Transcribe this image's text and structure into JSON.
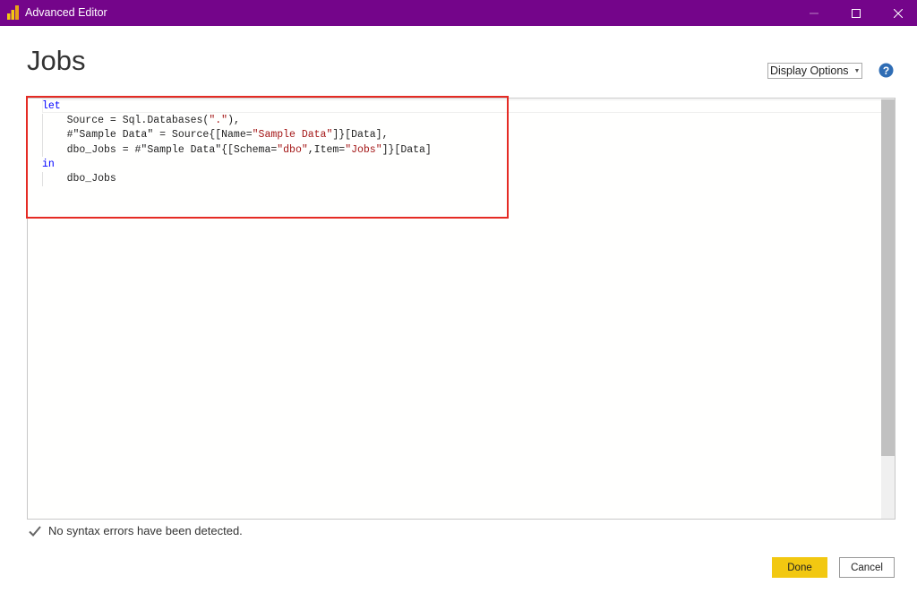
{
  "window": {
    "title": "Advanced Editor",
    "accent_color": "#74058a",
    "icon": "power-bi-icon",
    "controls": {
      "minimize_icon": "minimize-icon",
      "maximize_icon": "maximize-icon",
      "close_icon": "close-icon"
    }
  },
  "header": {
    "title": "Jobs",
    "display_options_label": "Display Options",
    "help_icon": "help-icon"
  },
  "editor": {
    "lines": [
      [
        {
          "t": "let",
          "c": "kw"
        }
      ],
      [
        {
          "t": "    Source = Sql.Databases(",
          "c": ""
        },
        {
          "t": "\".\"",
          "c": "str"
        },
        {
          "t": "),",
          "c": ""
        }
      ],
      [
        {
          "t": "    #\"Sample Data\" = Source{[Name=",
          "c": ""
        },
        {
          "t": "\"Sample Data\"",
          "c": "str"
        },
        {
          "t": "]}[Data],",
          "c": ""
        }
      ],
      [
        {
          "t": "    dbo_Jobs = #\"Sample Data\"{[Schema=",
          "c": ""
        },
        {
          "t": "\"dbo\"",
          "c": "str"
        },
        {
          "t": ",Item=",
          "c": ""
        },
        {
          "t": "\"Jobs\"",
          "c": "str"
        },
        {
          "t": "]}[Data]",
          "c": ""
        }
      ],
      [
        {
          "t": "in",
          "c": "kw"
        }
      ],
      [
        {
          "t": "    dbo_Jobs",
          "c": ""
        }
      ]
    ],
    "keyword_color": "#0000ff",
    "string_color": "#a31515",
    "highlight_color": "#e52b24"
  },
  "status": {
    "icon": "check-icon",
    "text": "No syntax errors have been detected."
  },
  "footer": {
    "done_label": "Done",
    "cancel_label": "Cancel",
    "done_color": "#f2c811"
  }
}
